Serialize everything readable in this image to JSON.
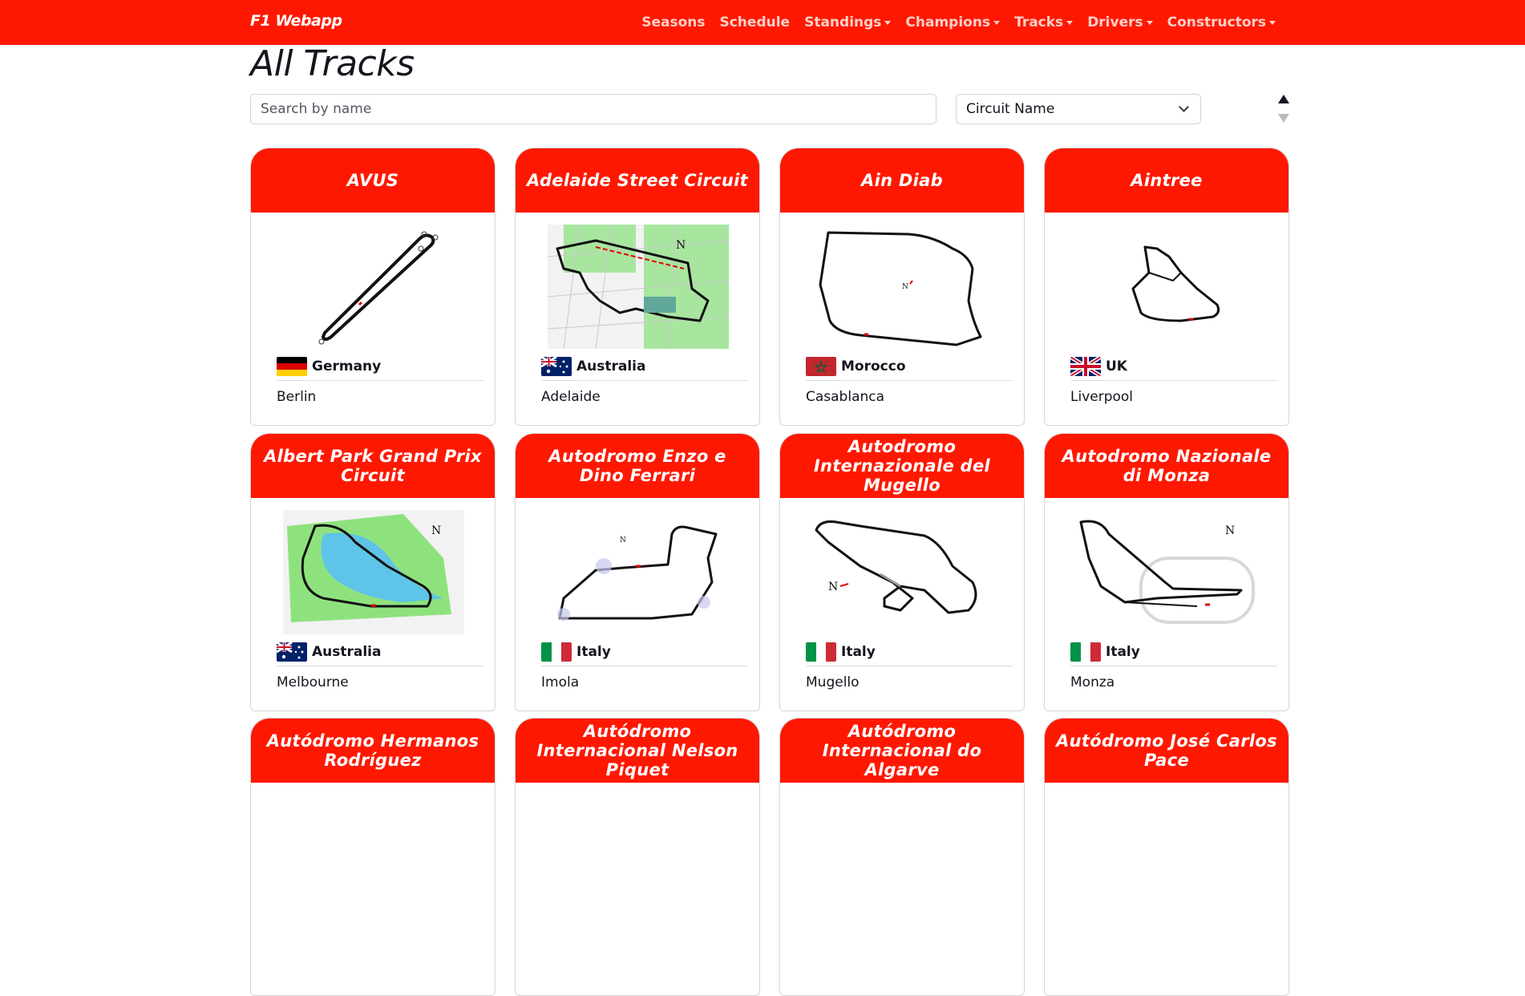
{
  "brand": "F1 Webapp",
  "nav": {
    "seasons": "Seasons",
    "schedule": "Schedule",
    "standings": "Standings",
    "champions": "Champions",
    "tracks": "Tracks",
    "drivers": "Drivers",
    "constructors": "Constructors"
  },
  "page": {
    "title": "All Tracks",
    "search_placeholder": "Search by name",
    "sort_selected": "Circuit Name"
  },
  "colors": {
    "brand_red": "#ff1801",
    "text": "#15151e"
  },
  "tracks": [
    {
      "name": "AVUS",
      "country": "Germany",
      "city": "Berlin",
      "flag": "germany-flag"
    },
    {
      "name": "Adelaide Street Circuit",
      "country": "Australia",
      "city": "Adelaide",
      "flag": "australia-flag"
    },
    {
      "name": "Ain Diab",
      "country": "Morocco",
      "city": "Casablanca",
      "flag": "morocco-flag"
    },
    {
      "name": "Aintree",
      "country": "UK",
      "city": "Liverpool",
      "flag": "uk-flag"
    },
    {
      "name": "Albert Park Grand Prix Circuit",
      "country": "Australia",
      "city": "Melbourne",
      "flag": "australia-flag"
    },
    {
      "name": "Autodromo Enzo e Dino Ferrari",
      "country": "Italy",
      "city": "Imola",
      "flag": "italy-flag"
    },
    {
      "name": "Autodromo Internazionale del Mugello",
      "country": "Italy",
      "city": "Mugello",
      "flag": "italy-flag"
    },
    {
      "name": "Autodromo Nazionale di Monza",
      "country": "Italy",
      "city": "Monza",
      "flag": "italy-flag"
    },
    {
      "name": "Autódromo Hermanos Rodríguez",
      "country": "",
      "city": "",
      "flag": ""
    },
    {
      "name": "Autódromo Internacional Nelson Piquet",
      "country": "",
      "city": "",
      "flag": ""
    },
    {
      "name": "Autódromo Internacional do Algarve",
      "country": "",
      "city": "",
      "flag": ""
    },
    {
      "name": "Autódromo José Carlos Pace",
      "country": "",
      "city": "",
      "flag": ""
    }
  ]
}
